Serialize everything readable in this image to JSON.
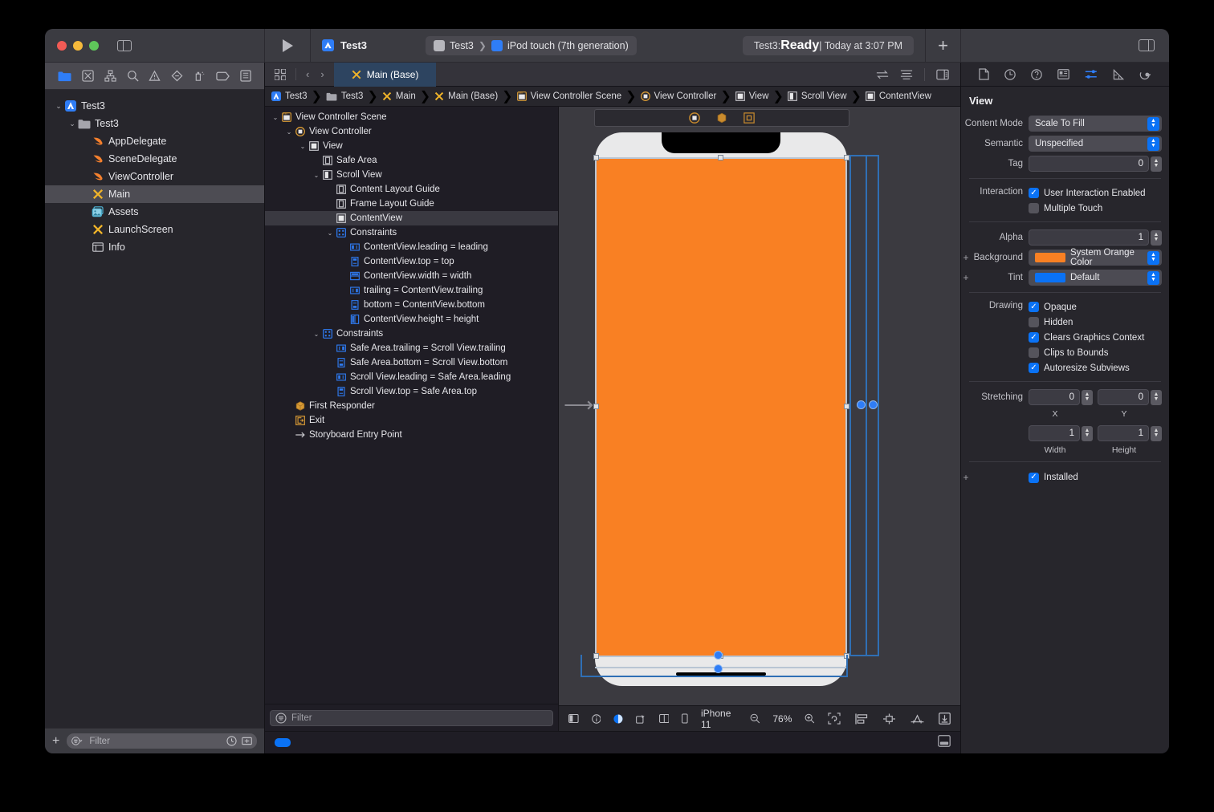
{
  "titlebar": {
    "app_name": "Test3",
    "scheme_project": "Test3",
    "scheme_device": "iPod touch (7th generation)",
    "status_prefix": "Test3: ",
    "status_state": "Ready",
    "status_suffix": " | Today at 3:07 PM",
    "add_label": "+"
  },
  "navigator": {
    "tabs": [
      "folder-icon",
      "source-control-icon",
      "symbol-icon",
      "find-icon",
      "issue-icon",
      "test-icon",
      "debug-icon",
      "breakpoint-icon",
      "report-icon"
    ],
    "items": [
      {
        "label": "Test3",
        "depth": 0,
        "twisty": "v",
        "icon": "project-icon",
        "selected": false
      },
      {
        "label": "Test3",
        "depth": 1,
        "twisty": "v",
        "icon": "folder-icon",
        "selected": false
      },
      {
        "label": "AppDelegate",
        "depth": 2,
        "twisty": "",
        "icon": "swift-icon",
        "selected": false
      },
      {
        "label": "SceneDelegate",
        "depth": 2,
        "twisty": "",
        "icon": "swift-icon",
        "selected": false
      },
      {
        "label": "ViewController",
        "depth": 2,
        "twisty": "",
        "icon": "swift-icon",
        "selected": false
      },
      {
        "label": "Main",
        "depth": 2,
        "twisty": "",
        "icon": "storyboard-icon",
        "selected": true
      },
      {
        "label": "Assets",
        "depth": 2,
        "twisty": "",
        "icon": "assets-icon",
        "selected": false
      },
      {
        "label": "LaunchScreen",
        "depth": 2,
        "twisty": "",
        "icon": "storyboard-icon",
        "selected": false
      },
      {
        "label": "Info",
        "depth": 2,
        "twisty": "",
        "icon": "plist-icon",
        "selected": false
      }
    ],
    "footer": {
      "add_label": "+",
      "filter_placeholder": "Filter"
    }
  },
  "editor": {
    "tab_label": "Main (Base)",
    "back_label": "‹",
    "forward_label": "›",
    "breadcrumb": [
      {
        "label": "Test3",
        "icon": "project-icon"
      },
      {
        "label": "Test3",
        "icon": "folder-icon"
      },
      {
        "label": "Main",
        "icon": "storyboard-icon"
      },
      {
        "label": "Main (Base)",
        "icon": "storyboard-icon"
      },
      {
        "label": "View Controller Scene",
        "icon": "scene-icon"
      },
      {
        "label": "View Controller",
        "icon": "viewcontroller-icon"
      },
      {
        "label": "View",
        "icon": "view-icon"
      },
      {
        "label": "Scroll View",
        "icon": "scrollview-icon"
      },
      {
        "label": "ContentView",
        "icon": "view-icon"
      }
    ]
  },
  "outline": {
    "items": [
      {
        "label": "View Controller Scene",
        "depth": 0,
        "twisty": "v",
        "icon": "scene-icon",
        "selected": false
      },
      {
        "label": "View Controller",
        "depth": 1,
        "twisty": "v",
        "icon": "viewcontroller-icon",
        "selected": false
      },
      {
        "label": "View",
        "depth": 2,
        "twisty": "v",
        "icon": "view-icon",
        "selected": false
      },
      {
        "label": "Safe Area",
        "depth": 3,
        "twisty": "",
        "icon": "guide-icon",
        "selected": false
      },
      {
        "label": "Scroll View",
        "depth": 3,
        "twisty": "v",
        "icon": "scrollview-icon",
        "selected": false
      },
      {
        "label": "Content Layout Guide",
        "depth": 4,
        "twisty": "",
        "icon": "guide-icon",
        "selected": false
      },
      {
        "label": "Frame Layout Guide",
        "depth": 4,
        "twisty": "",
        "icon": "guide-icon",
        "selected": false
      },
      {
        "label": "ContentView",
        "depth": 4,
        "twisty": "",
        "icon": "view-icon",
        "selected": true
      },
      {
        "label": "Constraints",
        "depth": 4,
        "twisty": "v",
        "icon": "constraints-icon",
        "selected": false
      },
      {
        "label": "ContentView.leading = leading",
        "depth": 5,
        "twisty": "",
        "icon": "constraint-leading-icon",
        "selected": false
      },
      {
        "label": "ContentView.top = top",
        "depth": 5,
        "twisty": "",
        "icon": "constraint-top-icon",
        "selected": false
      },
      {
        "label": "ContentView.width = width",
        "depth": 5,
        "twisty": "",
        "icon": "constraint-width-icon",
        "selected": false
      },
      {
        "label": "trailing = ContentView.trailing",
        "depth": 5,
        "twisty": "",
        "icon": "constraint-trailing-icon",
        "selected": false
      },
      {
        "label": "bottom = ContentView.bottom",
        "depth": 5,
        "twisty": "",
        "icon": "constraint-bottom-icon",
        "selected": false
      },
      {
        "label": "ContentView.height = height",
        "depth": 5,
        "twisty": "",
        "icon": "constraint-height-icon",
        "selected": false
      },
      {
        "label": "Constraints",
        "depth": 3,
        "twisty": "v",
        "icon": "constraints-icon",
        "selected": false
      },
      {
        "label": "Safe Area.trailing = Scroll View.trailing",
        "depth": 4,
        "twisty": "",
        "icon": "constraint-trailing-icon",
        "selected": false
      },
      {
        "label": "Safe Area.bottom = Scroll View.bottom",
        "depth": 4,
        "twisty": "",
        "icon": "constraint-bottom-icon",
        "selected": false
      },
      {
        "label": "Scroll View.leading = Safe Area.leading",
        "depth": 4,
        "twisty": "",
        "icon": "constraint-leading-icon",
        "selected": false
      },
      {
        "label": "Scroll View.top = Safe Area.top",
        "depth": 4,
        "twisty": "",
        "icon": "constraint-top-icon",
        "selected": false
      },
      {
        "label": "First Responder",
        "depth": 1,
        "twisty": "",
        "icon": "first-responder-icon",
        "selected": false
      },
      {
        "label": "Exit",
        "depth": 1,
        "twisty": "",
        "icon": "exit-icon",
        "selected": false
      },
      {
        "label": "Storyboard Entry Point",
        "depth": 1,
        "twisty": "",
        "icon": "entry-point-icon",
        "selected": false
      }
    ],
    "filter_placeholder": "Filter"
  },
  "canvas": {
    "device_label": "iPhone 11",
    "zoom_level": "76%",
    "zoom_out_icon": "zoom-out-icon",
    "zoom_in_icon": "zoom-in-icon",
    "left_tools": [
      "view-as-icon",
      "info-icon",
      "appearance-icon",
      "orientation-icon",
      "split-icon",
      "device-icon"
    ],
    "right_tools": [
      "update-frames-icon",
      "align-icon",
      "add-constraints-icon",
      "resolve-issues-icon",
      "embed-icon"
    ],
    "background_color": "#f98023"
  },
  "inspector": {
    "tabs": [
      "file-inspector-icon",
      "history-inspector-icon",
      "quick-help-icon",
      "identity-inspector-icon",
      "attributes-inspector-icon",
      "size-inspector-icon",
      "connections-inspector-icon"
    ],
    "title": "View",
    "content_mode": {
      "label": "Content Mode",
      "value": "Scale To Fill"
    },
    "semantic": {
      "label": "Semantic",
      "value": "Unspecified"
    },
    "tag": {
      "label": "Tag",
      "value": "0"
    },
    "interaction": {
      "label": "Interaction",
      "items": [
        {
          "label": "User Interaction Enabled",
          "checked": true
        },
        {
          "label": "Multiple Touch",
          "checked": false
        }
      ]
    },
    "alpha": {
      "label": "Alpha",
      "value": "1"
    },
    "background": {
      "label": "Background",
      "value": "System Orange Color",
      "color": "#f98023"
    },
    "tint": {
      "label": "Tint",
      "value": "Default",
      "color": "#0a72f5"
    },
    "drawing": {
      "label": "Drawing",
      "items": [
        {
          "label": "Opaque",
          "checked": true
        },
        {
          "label": "Hidden",
          "checked": false
        },
        {
          "label": "Clears Graphics Context",
          "checked": true
        },
        {
          "label": "Clips to Bounds",
          "checked": false
        },
        {
          "label": "Autoresize Subviews",
          "checked": true
        }
      ]
    },
    "stretching": {
      "label": "Stretching",
      "x": {
        "value": "0",
        "caption": "X"
      },
      "y": {
        "value": "0",
        "caption": "Y"
      },
      "width": {
        "value": "1",
        "caption": "Width"
      },
      "height": {
        "value": "1",
        "caption": "Height"
      }
    },
    "installed": {
      "label": "Installed",
      "checked": true
    }
  }
}
